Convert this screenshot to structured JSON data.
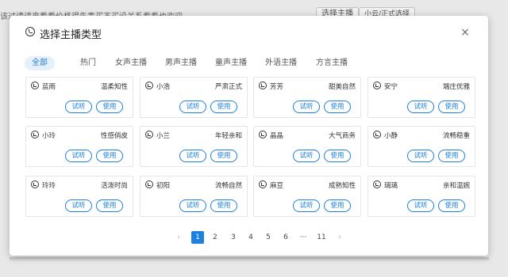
{
  "background": {
    "text": "该过请讲来看看价格得先事买不买设关系看看也欢迎",
    "primary_button": "选择主播",
    "secondary_button": "小云/正式选择"
  },
  "dialog": {
    "title": "选择主播类型",
    "close": "×"
  },
  "tabs": [
    {
      "label": "全部",
      "active": true
    },
    {
      "label": "热门"
    },
    {
      "label": "女声主播"
    },
    {
      "label": "男声主播"
    },
    {
      "label": "童声主播"
    },
    {
      "label": "外语主播"
    },
    {
      "label": "方言主播"
    }
  ],
  "buttons": {
    "listen": "试听",
    "use": "使用"
  },
  "anchors": [
    {
      "name": "蓝雨",
      "tag": "温柔知性"
    },
    {
      "name": "小浩",
      "tag": "严肃正式"
    },
    {
      "name": "芳芳",
      "tag": "甜美自然"
    },
    {
      "name": "安宁",
      "tag": "端庄优雅"
    },
    {
      "name": "小玲",
      "tag": "性感俏皮"
    },
    {
      "name": "小兰",
      "tag": "年轻亲和"
    },
    {
      "name": "晶晶",
      "tag": "大气商务"
    },
    {
      "name": "小静",
      "tag": "流畅稳重"
    },
    {
      "name": "玲玲",
      "tag": "活泼时尚"
    },
    {
      "name": "初阳",
      "tag": "流畅自然"
    },
    {
      "name": "麻豆",
      "tag": "成熟知性"
    },
    {
      "name": "璃璃",
      "tag": "亲和温婉"
    }
  ],
  "pagination": {
    "prev": "‹",
    "next": "›",
    "pages": [
      "1",
      "2",
      "3",
      "4",
      "5",
      "6",
      "···",
      "11"
    ],
    "current": "1"
  }
}
